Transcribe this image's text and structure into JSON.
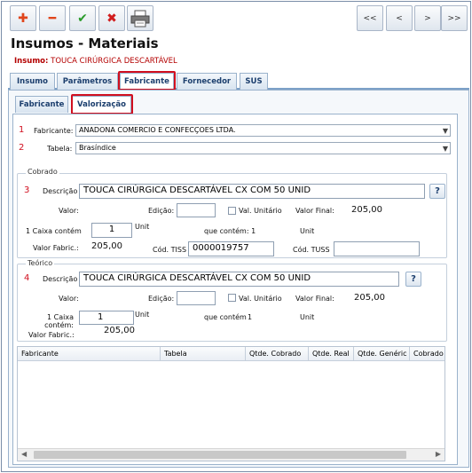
{
  "toolbar": {
    "add_icon": "plus-icon",
    "remove_icon": "minus-icon",
    "confirm_icon": "check-icon",
    "cancel_icon": "x-icon",
    "print_icon": "printer-icon",
    "nav_first": "<<",
    "nav_prev": "<",
    "nav_next": ">",
    "nav_last": ">>"
  },
  "page": {
    "title": "Insumos - Materiais",
    "insumo_label": "Insumo:",
    "insumo_value": "TOUCA CIRÚRGICA DESCARTÁVEL"
  },
  "tabs": [
    "Insumo",
    "Parâmetros",
    "Fabricante",
    "Fornecedor",
    "SUS"
  ],
  "active_tab": "Fabricante",
  "subtabs": [
    "Fabricante",
    "Valorização"
  ],
  "active_subtab": "Valorização",
  "form": {
    "fabricante_label": "Fabricante:",
    "fabricante_value": "ANADONA COMERCIO E CONFECÇOES LTDA.",
    "tabela_label": "Tabela:",
    "tabela_value": "Brasíndice"
  },
  "markers": [
    "1",
    "2",
    "3",
    "4"
  ],
  "cobrado": {
    "legend": "Cobrado",
    "descricao_label": "Descrição",
    "descricao_value": "TOUCA CIRÚRGICA DESCARTÁVEL CX COM 50 UNID",
    "valor_label": "Valor:",
    "edicao_label": "Edição:",
    "val_unitario_label": "Val. Unitário",
    "valor_final_label": "Valor Final:",
    "valor_final_value": "205,00",
    "caixa_label": "1 Caixa contém",
    "caixa_value": "1",
    "unit_label": "Unit",
    "que_contem_label": "que contém: 1",
    "unit2_label": "Unit",
    "valor_fabric_label": "Valor Fabric.:",
    "valor_fabric_value": "205,00",
    "cod_tiss_label": "Cód. TISS",
    "cod_tiss_value": "0000019757",
    "cod_tuss_label": "Cód. TUSS",
    "cod_tuss_value": ""
  },
  "teorico": {
    "legend": "Teórico",
    "descricao_label": "Descrição",
    "descricao_value": "TOUCA CIRÚRGICA DESCARTÁVEL CX COM 50 UNID",
    "valor_label": "Valor:",
    "edicao_label": "Edição:",
    "val_unitario_label": "Val. Unitário",
    "valor_final_label": "Valor Final:",
    "valor_final_value": "205,00",
    "caixa_label": "1 Caixa contém:",
    "caixa_value": "1",
    "unit_label": "Unit",
    "que_contem_label": "que contém",
    "que_contem_value": "1",
    "unit2_label": "Unit",
    "valor_fabric_label": "Valor Fabric.:",
    "valor_fabric_value": "205,00"
  },
  "help_button": "?",
  "grid": {
    "columns": [
      "Fabricante",
      "Tabela",
      "Qtde. Cobrado",
      "Qtde. Real",
      "Qtde. Genéric",
      "Cobrado"
    ],
    "rows": []
  }
}
